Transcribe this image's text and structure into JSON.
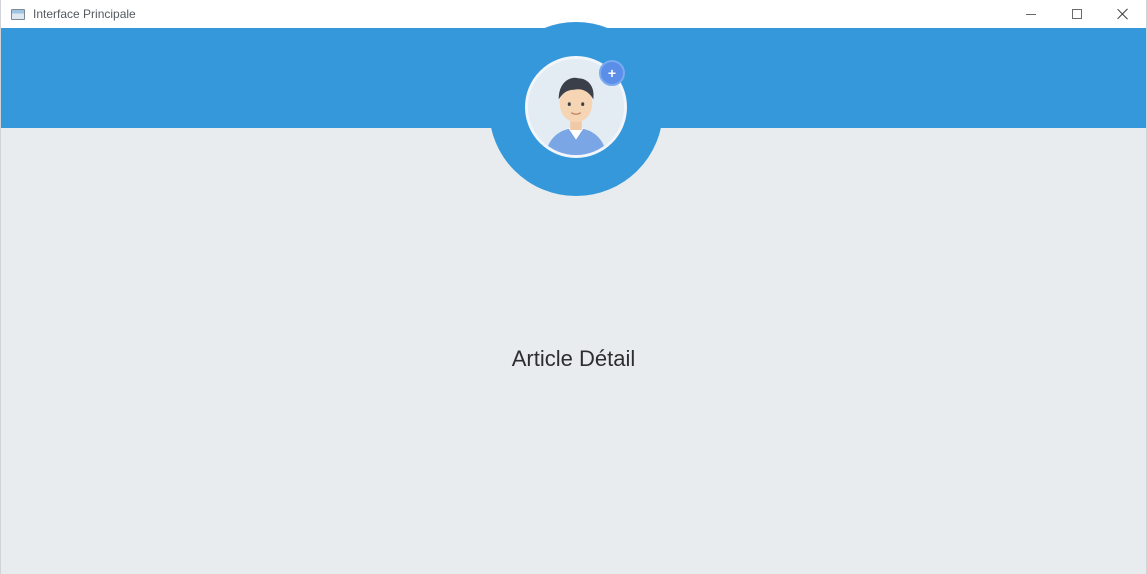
{
  "window": {
    "title": "Interface Principale",
    "controls": {
      "minimize_icon": "minimize-icon",
      "maximize_icon": "maximize-icon",
      "close_icon": "close-icon"
    }
  },
  "header": {
    "color": "#3498db",
    "avatar_icon": "user-avatar-icon",
    "badge_icon": "plus-icon",
    "badge_glyph": "+"
  },
  "main": {
    "label": "Article Détail",
    "background": "#e9ecee"
  }
}
